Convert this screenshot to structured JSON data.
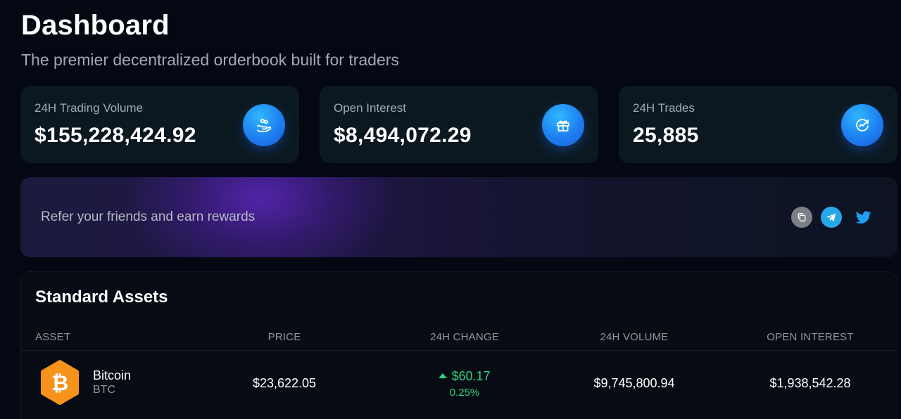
{
  "header": {
    "title": "Dashboard",
    "subtitle": "The premier decentralized orderbook built for traders"
  },
  "stats": [
    {
      "label": "24H Trading Volume",
      "value": "$155,228,424.92",
      "icon": "hand-coins-icon"
    },
    {
      "label": "Open Interest",
      "value": "$8,494,072.29",
      "icon": "gift-icon"
    },
    {
      "label": "24H Trades",
      "value": "25,885",
      "icon": "trend-cycle-icon"
    }
  ],
  "referral": {
    "text": "Refer your friends and earn rewards",
    "actions": [
      "copy-icon",
      "telegram-icon",
      "twitter-icon"
    ]
  },
  "assets": {
    "title": "Standard Assets",
    "columns": [
      "ASSET",
      "PRICE",
      "24H CHANGE",
      "24H VOLUME",
      "OPEN INTEREST"
    ],
    "rows": [
      {
        "name": "Bitcoin",
        "symbol": "BTC",
        "price": "$23,622.05",
        "change_abs": "$60.17",
        "change_pct": "0.25%",
        "volume": "$9,745,800.94",
        "open_interest": "$1,938,542.28"
      }
    ]
  },
  "colors": {
    "background": "#030812",
    "card": "#0b1820",
    "accent": "#1d7ff0",
    "positive": "#2ed47a",
    "bitcoin": "#f7931a"
  }
}
